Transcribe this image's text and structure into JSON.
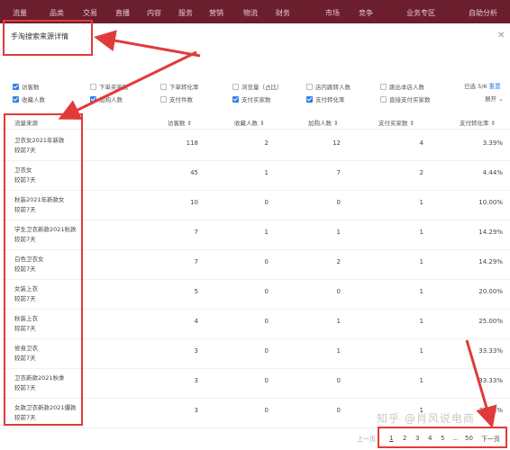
{
  "topnav": {
    "items": [
      "流量",
      "品类",
      "交易",
      "直播",
      "内容",
      "服务",
      "营销",
      "物流",
      "财务",
      "市场",
      "竞争",
      "业务专区",
      "自助分析"
    ]
  },
  "panel": {
    "title": "手淘搜索来源详情",
    "close_icon": "close-icon"
  },
  "checkboxes": [
    {
      "label": "访客数",
      "checked": true
    },
    {
      "label": "下单买家数",
      "checked": false
    },
    {
      "label": "下单转化率",
      "checked": false
    },
    {
      "label": "浏览量（占比）",
      "checked": false
    },
    {
      "label": "店内跳转人数",
      "checked": false
    },
    {
      "label": "跳出本店人数",
      "checked": false
    },
    {
      "label": "收藏人数",
      "checked": true
    },
    {
      "label": "加购人数",
      "checked": true
    },
    {
      "label": "支付件数",
      "checked": false
    },
    {
      "label": "支付买家数",
      "checked": true
    },
    {
      "label": "支付转化率",
      "checked": true
    },
    {
      "label": "直接支付买家数",
      "checked": false
    }
  ],
  "selection": {
    "selected_text": "已选 5/6",
    "reset_label": "重置",
    "expand_label": "展开 ⌄"
  },
  "table": {
    "headers": [
      "流量来源",
      "访客数 ⇕",
      "收藏人数 ⇕",
      "加购人数 ⇕",
      "支付买家数 ⇕",
      "支付转化率 ⇕"
    ],
    "rows": [
      {
        "source": "卫衣女2021年新款",
        "compare": "较前7天",
        "visitors": "118",
        "favorites": "2",
        "carts": "12",
        "buyers": "4",
        "conversion": "3.39%"
      },
      {
        "source": "卫衣女",
        "compare": "较前7天",
        "visitors": "45",
        "favorites": "1",
        "carts": "7",
        "buyers": "2",
        "conversion": "4.44%"
      },
      {
        "source": "秋装2021年新款女",
        "compare": "较前7天",
        "visitors": "10",
        "favorites": "0",
        "carts": "0",
        "buyers": "1",
        "conversion": "10.00%"
      },
      {
        "source": "学生卫衣新款2021秋款",
        "compare": "较前7天",
        "visitors": "7",
        "favorites": "1",
        "carts": "1",
        "buyers": "1",
        "conversion": "14.29%"
      },
      {
        "source": "白色卫衣女",
        "compare": "较前7天",
        "visitors": "7",
        "favorites": "0",
        "carts": "2",
        "buyers": "1",
        "conversion": "14.29%"
      },
      {
        "source": "女装上衣",
        "compare": "较前7天",
        "visitors": "5",
        "favorites": "0",
        "carts": "0",
        "buyers": "1",
        "conversion": "20.00%"
      },
      {
        "source": "秋装上衣",
        "compare": "较前7天",
        "visitors": "4",
        "favorites": "0",
        "carts": "1",
        "buyers": "1",
        "conversion": "25.00%"
      },
      {
        "source": "修身卫衣",
        "compare": "较前7天",
        "visitors": "3",
        "favorites": "0",
        "carts": "1",
        "buyers": "1",
        "conversion": "33.33%"
      },
      {
        "source": "卫衣新款2021秋季",
        "compare": "较前7天",
        "visitors": "3",
        "favorites": "0",
        "carts": "0",
        "buyers": "1",
        "conversion": "33.33%"
      },
      {
        "source": "女款卫衣新款2021爆款",
        "compare": "较前7天",
        "visitors": "3",
        "favorites": "0",
        "carts": "0",
        "buyers": "1",
        "conversion": "33.33%"
      }
    ]
  },
  "pagination": {
    "prev": "上一页",
    "pages": [
      "1",
      "2",
      "3",
      "4",
      "5",
      "...",
      "50"
    ],
    "next": "下一页"
  },
  "watermark": "知乎 @肖风说电商",
  "colors": {
    "nav_bg": "#6b1e2e",
    "checkbox_on": "#2f7ee6",
    "annotation_red": "#e23a3a"
  }
}
